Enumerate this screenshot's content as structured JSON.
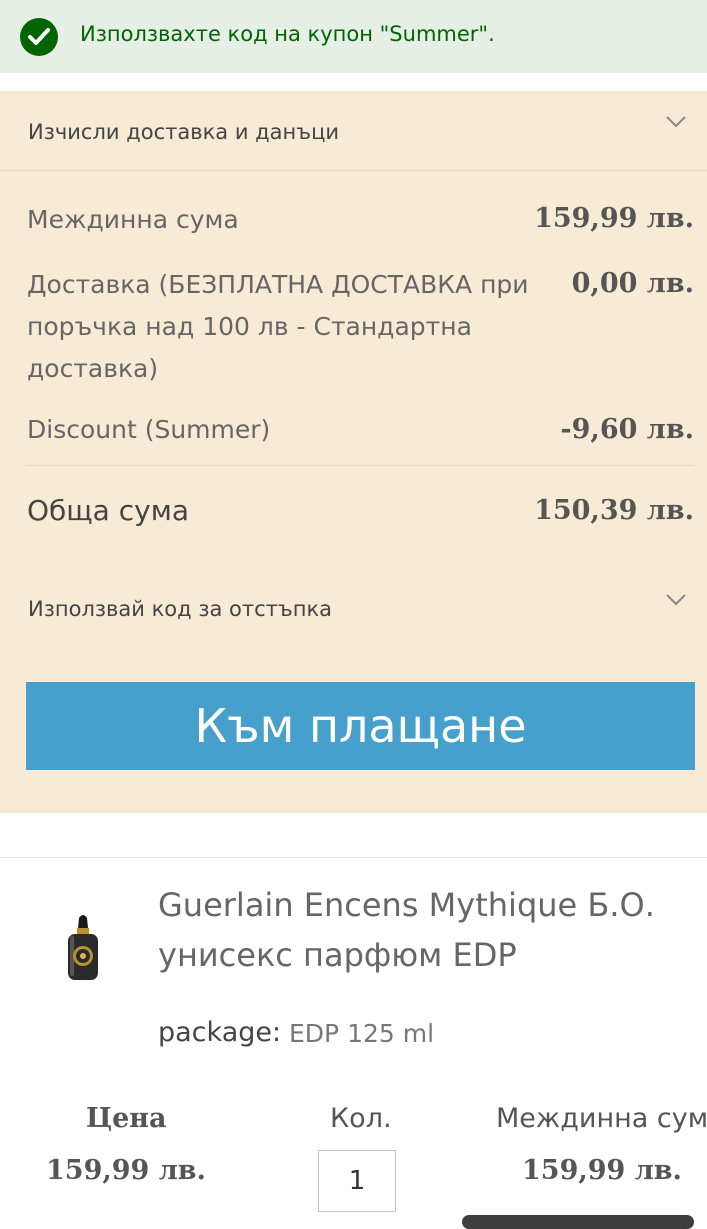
{
  "banner": {
    "message": "Използвахте код на купон \"Summer\"."
  },
  "summary": {
    "shipping_tax_title": "Изчисли доставка и данъци",
    "lines": [
      {
        "label": "Междинна сума",
        "amount": "159,99 лв."
      },
      {
        "label": "Доставка (БЕЗПЛАТНА ДОСТАВКА при поръчка над 100 лв - Стандартна доставка)",
        "amount": "0,00 лв."
      },
      {
        "label": "Discount (Summer)",
        "amount": "-9,60 лв."
      }
    ],
    "total_label": "Обща сума",
    "total_amount": "150,39 лв.",
    "discount_code_title": "Използвай код за отстъпка",
    "checkout_label": "Към плащане"
  },
  "product": {
    "name": "Guerlain Encens Mythique Б.О. унисекс парфюм EDP",
    "option_label": "package:",
    "option_value": "EDP 125 ml",
    "price_header": "Цена",
    "price": "159,99 лв.",
    "qty_header": "Кол.",
    "qty": "1",
    "subtotal_header": "Междинна сума",
    "subtotal": "159,99 лв."
  },
  "colors": {
    "banner_bg": "#e5efe5",
    "success_green": "#006400",
    "summary_bg": "#f7ebd6",
    "checkout_blue": "#47a0cc"
  },
  "icons": [
    "check-circle-icon",
    "chevron-down-icon"
  ]
}
